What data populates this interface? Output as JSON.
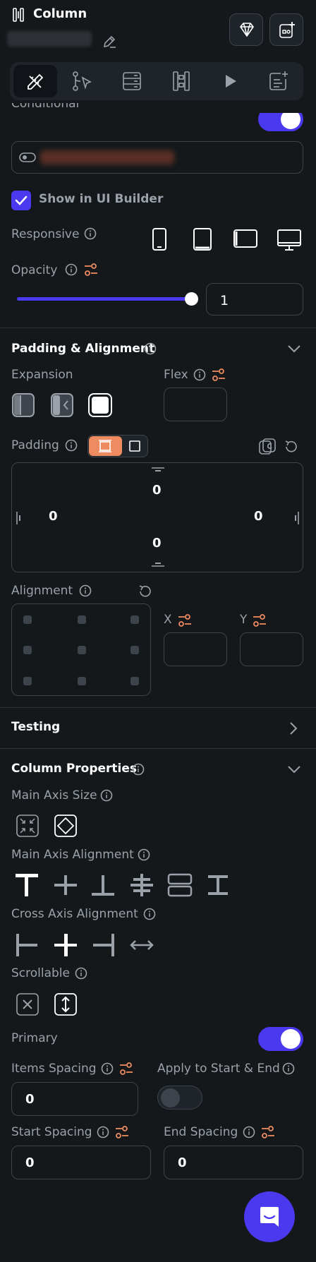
{
  "header": {
    "title": "Column",
    "name_value": "Column"
  },
  "tabs": [
    "properties-icon",
    "actions-icon",
    "backend-query-icon",
    "widget-tree-icon",
    "run-icon",
    "notes-icon"
  ],
  "conditional": {
    "label": "Conditional",
    "enabled": true
  },
  "show_builder": {
    "label": "Show in UI Builder",
    "checked": true
  },
  "responsive": {
    "label": "Responsive"
  },
  "opacity": {
    "label": "Opacity",
    "value": "1",
    "level": 1
  },
  "padding_alignment": {
    "title": "Padding & Alignment",
    "expansion_label": "Expansion",
    "flex_label": "Flex",
    "padding_label": "Padding",
    "padding": {
      "top": "0",
      "left": "0",
      "right": "0",
      "bottom": "0"
    },
    "alignment_label": "Alignment",
    "x_label": "X",
    "y_label": "Y"
  },
  "testing": {
    "title": "Testing"
  },
  "column_props": {
    "title": "Column Properties",
    "main_axis_size": "Main Axis Size",
    "main_axis_alignment": "Main Axis Alignment",
    "cross_axis_alignment": "Cross Axis Alignment",
    "scrollable": "Scrollable",
    "primary": "Primary",
    "primary_on": true,
    "items_spacing": "Items Spacing",
    "items_spacing_value": "0",
    "apply_start_end": "Apply to Start & End",
    "apply_on": false,
    "start_spacing": "Start Spacing",
    "start_spacing_value": "0",
    "end_spacing": "End Spacing",
    "end_spacing_value": "0"
  },
  "colors": {
    "accent": "#4b39ef",
    "orange": "#ee8b60",
    "bg": "#14181b"
  }
}
